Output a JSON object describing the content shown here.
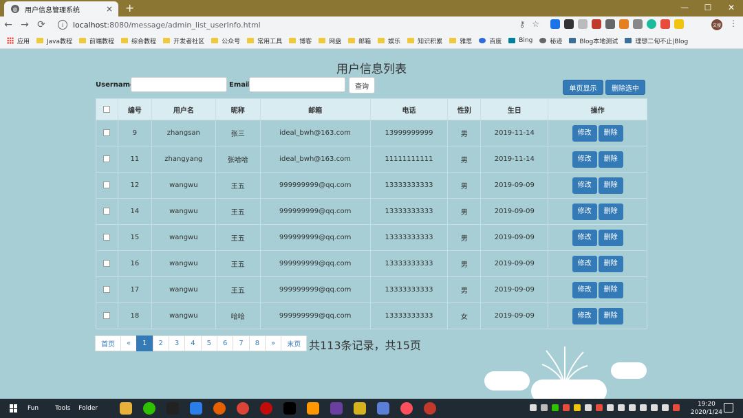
{
  "browser": {
    "tab_title": "用户信息管理系统",
    "url_host": "localhost",
    "url_path": ":8080/message/admin_list_userInfo.html",
    "bookmarks": [
      "应用",
      "Java教程",
      "前端教程",
      "综合教程",
      "开发者社区",
      "公众号",
      "常用工具",
      "博客",
      "网盘",
      "邮箱",
      "娱乐",
      "知识积累",
      "雅思",
      "百度",
      "Bing",
      "秘迹",
      "Blog本地测试",
      "理想二旬不止|Blog"
    ],
    "profile": "文搜"
  },
  "page": {
    "title": "用户信息列表",
    "search": {
      "username_label": "Username",
      "email_label": "Email",
      "username_value": "",
      "email_value": "",
      "query_button": "查询"
    },
    "actions": {
      "single_page_button": "单页显示",
      "delete_selected_button": "删除选中"
    },
    "table": {
      "headers": [
        "编号",
        "用户名",
        "昵称",
        "邮箱",
        "电话",
        "性别",
        "生日",
        "操作"
      ],
      "edit_label": "修改",
      "delete_label": "删除",
      "rows": [
        {
          "id": "9",
          "username": "zhangsan",
          "nickname": "张三",
          "email": "ideal_bwh@163.com",
          "phone": "13999999999",
          "gender": "男",
          "birthday": "2019-11-14"
        },
        {
          "id": "11",
          "username": "zhangyang",
          "nickname": "张哈哈",
          "email": "ideal_bwh@163.com",
          "phone": "11111111111",
          "gender": "男",
          "birthday": "2019-11-14"
        },
        {
          "id": "12",
          "username": "wangwu",
          "nickname": "王五",
          "email": "999999999@qq.com",
          "phone": "13333333333",
          "gender": "男",
          "birthday": "2019-09-09"
        },
        {
          "id": "14",
          "username": "wangwu",
          "nickname": "王五",
          "email": "999999999@qq.com",
          "phone": "13333333333",
          "gender": "男",
          "birthday": "2019-09-09"
        },
        {
          "id": "15",
          "username": "wangwu",
          "nickname": "王五",
          "email": "999999999@qq.com",
          "phone": "13333333333",
          "gender": "男",
          "birthday": "2019-09-09"
        },
        {
          "id": "16",
          "username": "wangwu",
          "nickname": "王五",
          "email": "999999999@qq.com",
          "phone": "13333333333",
          "gender": "男",
          "birthday": "2019-09-09"
        },
        {
          "id": "17",
          "username": "wangwu",
          "nickname": "王五",
          "email": "999999999@qq.com",
          "phone": "13333333333",
          "gender": "男",
          "birthday": "2019-09-09"
        },
        {
          "id": "18",
          "username": "wangwu",
          "nickname": "哈哈",
          "email": "999999999@qq.com",
          "phone": "13333333333",
          "gender": "女",
          "birthday": "2019-09-09"
        }
      ]
    },
    "pagination": {
      "first": "首页",
      "prev": "«",
      "pages": [
        "1",
        "2",
        "3",
        "4",
        "5",
        "6",
        "7",
        "8"
      ],
      "active": "1",
      "next": "»",
      "last": "末页",
      "summary": "共113条记录，共15页"
    }
  },
  "taskbar": {
    "labels": [
      "Fun",
      "Tools",
      "Folder"
    ],
    "time": "19:20",
    "date": "2020/1/24"
  }
}
